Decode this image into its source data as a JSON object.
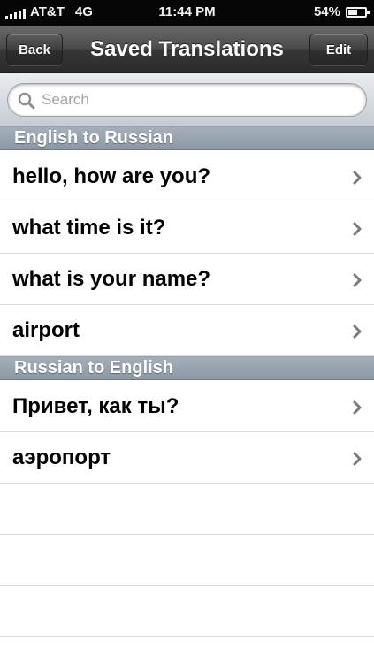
{
  "status_bar": {
    "carrier": "AT&T",
    "network": "4G",
    "time": "11:44 PM",
    "battery_percent": "54%",
    "battery_level": 0.54
  },
  "nav": {
    "back_label": "Back",
    "title": "Saved Translations",
    "edit_label": "Edit"
  },
  "search": {
    "placeholder": "Search",
    "value": ""
  },
  "sections": [
    {
      "header": "English to Russian",
      "items": [
        {
          "label": "hello, how are you?"
        },
        {
          "label": "what time is it?"
        },
        {
          "label": "what is your name?"
        },
        {
          "label": "airport"
        }
      ]
    },
    {
      "header": "Russian to English",
      "items": [
        {
          "label": "Привет, как ты?"
        },
        {
          "label": "аэропорт"
        }
      ]
    }
  ],
  "icons": {
    "signal": "signal-bars-icon",
    "battery": "battery-icon",
    "search": "search-icon",
    "disclosure": "chevron-right-icon"
  },
  "colors": {
    "nav_bar": "#3b3b3b",
    "section_header": "#97a2ae",
    "chevron": "#7a7a7a",
    "placeholder": "#a3a3a3"
  }
}
